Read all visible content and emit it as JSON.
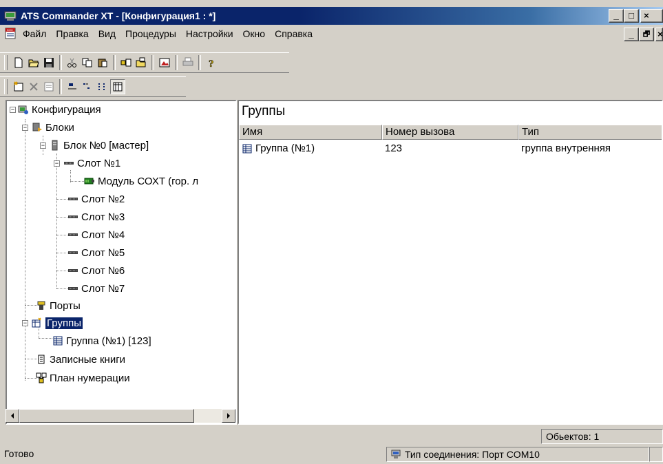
{
  "window": {
    "title": "ATS Commander XT - [Конфигурация1 : *]",
    "min": "_",
    "max": "□",
    "close": "×",
    "child_min": "_",
    "child_restore": "🗗",
    "child_close": "×"
  },
  "menu": [
    "Файл",
    "Правка",
    "Вид",
    "Процедуры",
    "Настройки",
    "Окно",
    "Справка"
  ],
  "toolbar1": [
    "new-icon",
    "open-icon",
    "save-icon",
    "cut-icon",
    "copy-icon",
    "paste-icon",
    "add-block-icon",
    "open-folder-icon",
    "view-icon",
    "print-icon",
    "help-icon"
  ],
  "toolbar2": [
    "add-object-icon",
    "delete-icon",
    "properties-icon",
    "large-icons-icon",
    "small-icons-icon",
    "list-icon",
    "details-icon"
  ],
  "tree": {
    "root": "Конфигурация",
    "blocks": "Блоки",
    "block0": "Блок №0 [мастер]",
    "slot1": "Слот №1",
    "module": "Модуль СОХТ (гор. л",
    "slot2": "Слот №2",
    "slot3": "Слот №3",
    "slot4": "Слот №4",
    "slot5": "Слот №5",
    "slot6": "Слот №6",
    "slot7": "Слот №7",
    "ports": "Порты",
    "groups": "Группы",
    "group1": "Группа (№1) [123]",
    "notebooks": "Записные книги",
    "numbering": "План нумерации"
  },
  "list": {
    "title": "Группы",
    "columns": [
      "Имя",
      "Номер вызова",
      "Тип"
    ],
    "rows": [
      {
        "name": "Группа (№1)",
        "number": "123",
        "type": "группа внутренняя"
      }
    ]
  },
  "status": {
    "objects": "Обьектов: 1",
    "ready": "Готово",
    "connection": "Тип соединения: Порт COM10"
  }
}
